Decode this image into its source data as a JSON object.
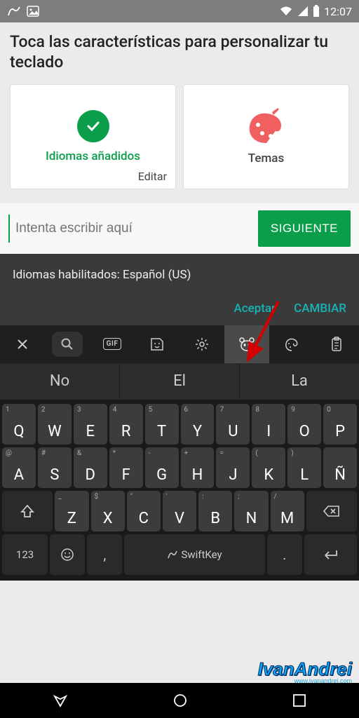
{
  "status": {
    "time": "12:07"
  },
  "onboard": {
    "title": "Toca las características para personalizar tu teclado",
    "card_lang": {
      "label": "Idiomas añadidos",
      "edit": "Editar"
    },
    "card_themes": {
      "label": "Temas"
    }
  },
  "input": {
    "placeholder": "Intenta escribir aquí",
    "next": "SIGUIENTE"
  },
  "lang_prompt": {
    "text": "Idiomas habilitados: Español (US)",
    "accept": "Aceptar",
    "change": "CAMBIAR"
  },
  "toolbar": {
    "gif": "GIF"
  },
  "suggestions": [
    "No",
    "El",
    "La"
  ],
  "keys": {
    "row1": [
      {
        "k": "Q",
        "s": "1"
      },
      {
        "k": "W",
        "s": "2"
      },
      {
        "k": "E",
        "s": "3"
      },
      {
        "k": "R",
        "s": "4"
      },
      {
        "k": "T",
        "s": "5"
      },
      {
        "k": "Y",
        "s": "6"
      },
      {
        "k": "U",
        "s": "7"
      },
      {
        "k": "I",
        "s": "8"
      },
      {
        "k": "O",
        "s": "9"
      },
      {
        "k": "P",
        "s": "0"
      }
    ],
    "row2": [
      {
        "k": "A",
        "s": "@"
      },
      {
        "k": "S",
        "s": "#"
      },
      {
        "k": "D",
        "s": "&"
      },
      {
        "k": "F",
        "s": "*"
      },
      {
        "k": "G",
        "s": "-"
      },
      {
        "k": "H",
        "s": "+"
      },
      {
        "k": "J",
        "s": "="
      },
      {
        "k": "K",
        "s": "("
      },
      {
        "k": "L",
        "s": ")"
      },
      {
        "k": "Ñ",
        "s": ""
      }
    ],
    "row3": [
      {
        "k": "Z",
        "s": "_"
      },
      {
        "k": "X",
        "s": "$"
      },
      {
        "k": "C",
        "s": "\""
      },
      {
        "k": "V",
        "s": "'"
      },
      {
        "k": "B",
        "s": ":"
      },
      {
        "k": "N",
        "s": ";"
      },
      {
        "k": "M",
        "s": "/"
      }
    ],
    "num": "123",
    "comma": ",",
    "space": "SwiftKey",
    "period": "."
  },
  "watermark": {
    "main": "IvanAndrei",
    "sub": "www.ivanandrei.com"
  }
}
